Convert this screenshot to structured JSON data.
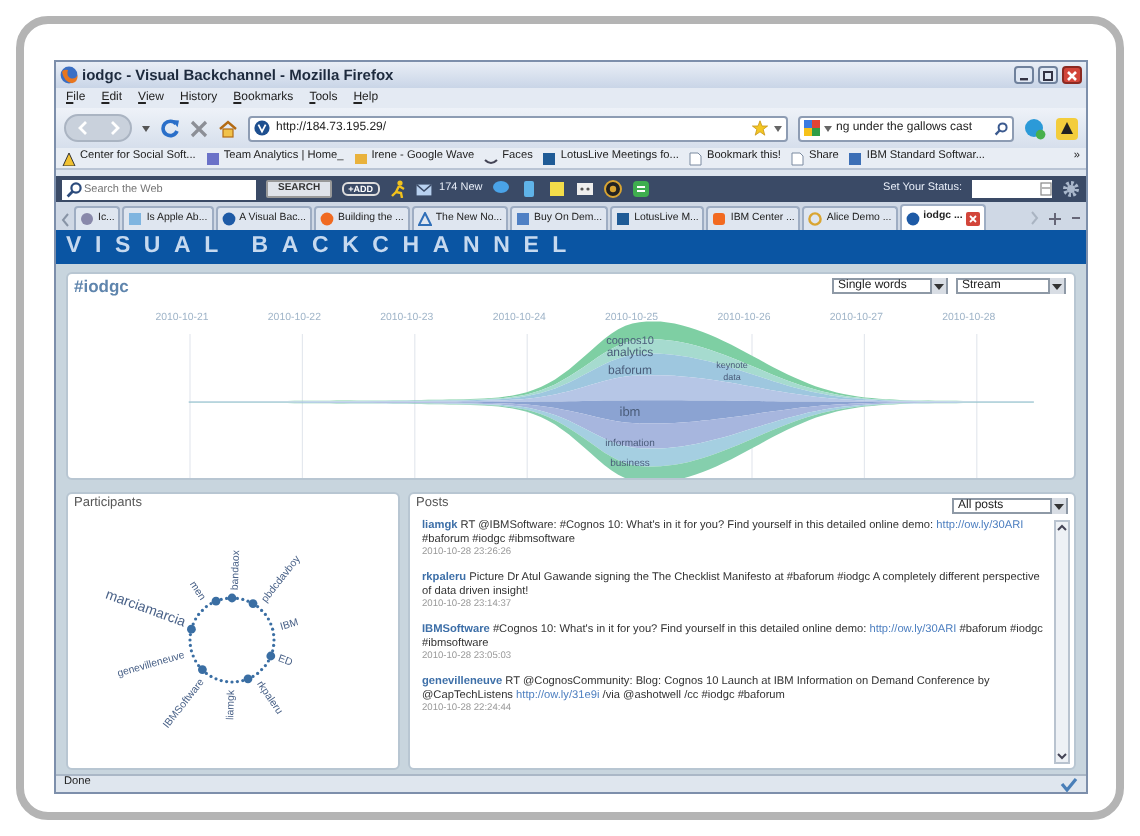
{
  "window": {
    "title": "iodgc - Visual Backchannel - Mozilla Firefox"
  },
  "menu": [
    "File",
    "Edit",
    "View",
    "History",
    "Bookmarks",
    "Tools",
    "Help"
  ],
  "address": {
    "value": "http://184.73.195.29/"
  },
  "search": {
    "value": "ng under the gallows cast"
  },
  "bookmarks": [
    "Center for Social Soft...",
    "Team Analytics | Home_",
    "Irene - Google Wave",
    "Faces",
    "LotusLive Meetings fo...",
    "Bookmark this!",
    "Share",
    "IBM Standard Softwar..."
  ],
  "bookmarks_more": "»",
  "addon_toolbar": {
    "search_placeholder": "Search the Web",
    "search_button": "SEARCH",
    "add_button": "+ADD",
    "mail": "174 New",
    "status_label": "Set Your Status:"
  },
  "tabs": [
    {
      "label": "Ic...",
      "selected": false
    },
    {
      "label": "Is Apple Ab...",
      "selected": false
    },
    {
      "label": "A Visual Bac...",
      "selected": false
    },
    {
      "label": "Building the ...",
      "selected": false
    },
    {
      "label": "The New No...",
      "selected": false
    },
    {
      "label": "Buy On Dem...",
      "selected": false
    },
    {
      "label": "LotusLive M...",
      "selected": false
    },
    {
      "label": "IBM Center ...",
      "selected": false
    },
    {
      "label": "Alice Demo ...",
      "selected": false
    },
    {
      "label": "iodgc ...",
      "selected": true
    }
  ],
  "app": {
    "banner": "VISUAL BACKCHANNEL"
  },
  "stream": {
    "title": "#iodgc",
    "word_mode": "Single words",
    "view": "Stream",
    "dates": [
      "2010-10-21",
      "2010-10-22",
      "2010-10-23",
      "2010-10-24",
      "2010-10-25",
      "2010-10-26",
      "2010-10-27",
      "2010-10-28"
    ],
    "words": [
      "cognos10",
      "analytics",
      "baforum",
      "ibm",
      "information",
      "business",
      "keynote",
      "data"
    ]
  },
  "participants": {
    "title": "Participants",
    "names": [
      "marciamarcia",
      "men",
      "bandaox",
      "pbdcdavboy",
      "IBM",
      "ED",
      "rkpaleru",
      "liamgk",
      "IBMSoftware",
      "genevilleneuve"
    ]
  },
  "posts": {
    "title": "Posts",
    "filter": "All posts",
    "items": [
      {
        "parts": [
          {
            "kind": "user",
            "text": "liamgk"
          },
          {
            "kind": "text",
            "text": " RT @IBMSoftware: #Cognos 10: What's in it for you? Find yourself in this detailed online demo: "
          },
          {
            "kind": "link",
            "text": "http://ow.ly/30ARI"
          },
          {
            "kind": "text",
            "text": " #baforum #iodgc #ibmsoftware"
          }
        ],
        "time": "2010-10-28 23:26:26"
      },
      {
        "parts": [
          {
            "kind": "user",
            "text": "rkpaleru"
          },
          {
            "kind": "text",
            "text": " Picture Dr Atul Gawande signing the The Checklist Manifesto at #baforum #iodgc A completely different perspective of data driven insight!"
          }
        ],
        "time": "2010-10-28 23:14:37"
      },
      {
        "parts": [
          {
            "kind": "user",
            "text": "IBMSoftware"
          },
          {
            "kind": "text",
            "text": " #Cognos 10: What's in it for you? Find yourself in this detailed online demo: "
          },
          {
            "kind": "link",
            "text": "http://ow.ly/30ARI"
          },
          {
            "kind": "text",
            "text": " #baforum #iodgc #ibmsoftware"
          }
        ],
        "time": "2010-10-28 23:05:03"
      },
      {
        "parts": [
          {
            "kind": "user",
            "text": "genevilleneuve"
          },
          {
            "kind": "text",
            "text": " RT @CognosCommunity: Blog: Cognos 10 Launch at IBM Information on Demand Conference by @CapTechListens "
          },
          {
            "kind": "link",
            "text": "http://ow.ly/31e9i"
          },
          {
            "kind": "text",
            "text": " /via @ashotwell /cc #iodgc #baforum"
          }
        ],
        "time": "2010-10-28 22:24:44"
      }
    ]
  },
  "status_bar": {
    "text": "Done"
  }
}
